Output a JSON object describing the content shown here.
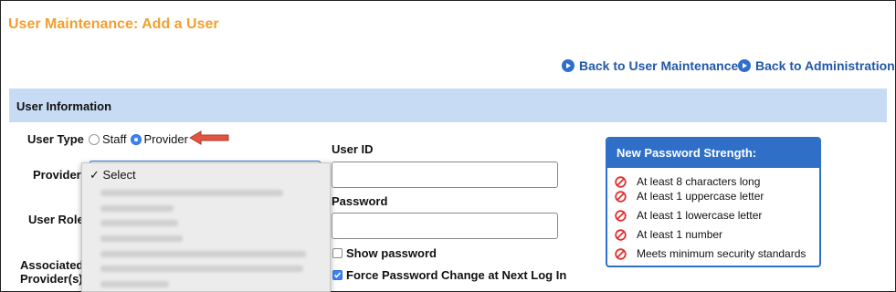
{
  "page": {
    "title": "User Maintenance: Add a User"
  },
  "nav": {
    "back_user_maintenance": "Back to User Maintenance",
    "back_administration": "Back to Administration"
  },
  "section": {
    "title": "User Information"
  },
  "form": {
    "user_type_label": "User Type",
    "user_type_options": [
      "Staff",
      "Provider"
    ],
    "user_type_selected": "Provider",
    "provider_label": "Provider",
    "provider_dropdown_selected": "Select",
    "user_role_label": "User Role",
    "associated_label_1": "Associated",
    "associated_label_2": "Provider(s)",
    "user_id_label": "User ID",
    "user_id_value": "",
    "password_label": "Password",
    "password_value": "",
    "show_password_label": "Show password",
    "show_password_checked": false,
    "force_change_label": "Force Password Change at Next Log In",
    "force_change_checked": true
  },
  "strength": {
    "title": "New Password Strength:",
    "rules": [
      "At least 8 characters long",
      "At least 1 uppercase letter",
      "At least 1 lowercase letter",
      "At least 1 number",
      "Meets minimum security standards"
    ]
  },
  "colors": {
    "title_orange": "#f0a030",
    "link_blue": "#2358a8",
    "section_bg": "#c7dbf4",
    "strength_blue": "#2f6fc8",
    "fail_red": "#e03030",
    "arrow_red": "#e05540"
  }
}
